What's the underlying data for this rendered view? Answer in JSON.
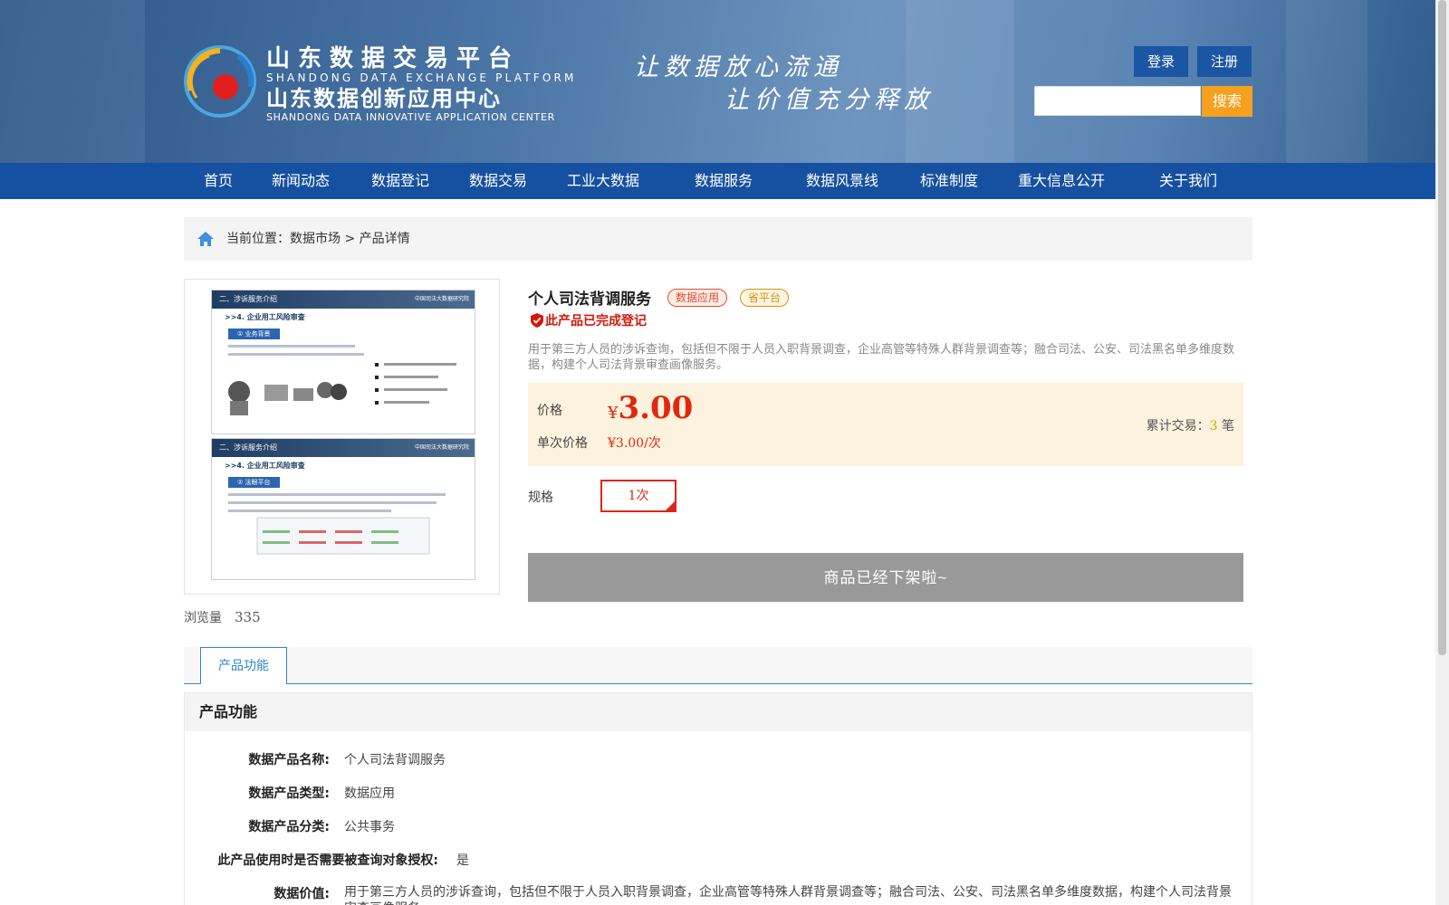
{
  "header": {
    "brand_cn_1": "山东数据交易平台",
    "brand_en_1": "SHANDONG DATA EXCHANGE PLATFORM",
    "brand_cn_2": "山东数据创新应用中心",
    "brand_en_2": "SHANDONG DATA INNOVATIVE APPLICATION CENTER",
    "slogan_1": "让数据放心流通",
    "slogan_2": "让价值充分释放",
    "login_label": "登录",
    "register_label": "注册",
    "search_placeholder": "",
    "search_label": "搜索"
  },
  "nav": [
    "首页",
    "新闻动态",
    "数据登记",
    "数据交易",
    "工业大数据",
    "数据服务",
    "数据风景线",
    "标准制度",
    "重大信息公开",
    "关于我们"
  ],
  "breadcrumb": {
    "prefix": "当前位置：",
    "market": "数据市场",
    "sep": ">",
    "current": "产品详情"
  },
  "image_slides": {
    "slide1_title": "二、涉诉服务介绍",
    "slide1_sub": ">>4. 企业用工风险审查",
    "slide1_pill": "① 业务背景",
    "slide2_title": "二、涉诉服务介绍",
    "slide2_sub": ">>4. 企业用工风险审查",
    "slide2_pill": "② 法眼平台",
    "org": "中国司法大数据研究院"
  },
  "views": {
    "label": "浏览量",
    "count": "335"
  },
  "product": {
    "title": "个人司法背调服务",
    "tag_1": "数据应用",
    "tag_2": "省平台",
    "registered": "此产品已完成登记",
    "description": "用于第三方人员的涉诉查询，包括但不限于人员入职背景调查，企业高管等特殊人群背景调查等；融合司法、公安、司法黑名单多维度数据，构建个人司法背景审查画像服务。",
    "price_label": "价格",
    "price_symbol": "¥",
    "price": "3.00",
    "unit_label": "单次价格",
    "unit_price": "¥3.00/次",
    "total_label": "累计交易：",
    "total_count": "3",
    "total_unit": "笔",
    "spec_label": "规格",
    "spec_option": "1次",
    "offline_label": "商品已经下架啦~"
  },
  "tabs": {
    "active": "产品功能"
  },
  "section": {
    "title": "产品功能",
    "rows": [
      {
        "k": "数据产品名称:",
        "v": "个人司法背调服务"
      },
      {
        "k": "数据产品类型:",
        "v": "数据应用"
      },
      {
        "k": "数据产品分类:",
        "v": "公共事务"
      },
      {
        "k": "此产品使用时是否需要被查询对象授权:",
        "v": "是"
      },
      {
        "k": "数据价值:",
        "v": "用于第三方人员的涉诉查询，包括但不限于人员入职背景调查，企业高管等特殊人群背景调查等；融合司法、公安、司法黑名单多维度数据，构建个人司法背景审查画像服务。"
      }
    ]
  },
  "colors": {
    "nav_bg": "#1650a0",
    "accent_orange": "#f5a01e",
    "price_red": "#e0280f",
    "tab_blue": "#2d87c8"
  }
}
